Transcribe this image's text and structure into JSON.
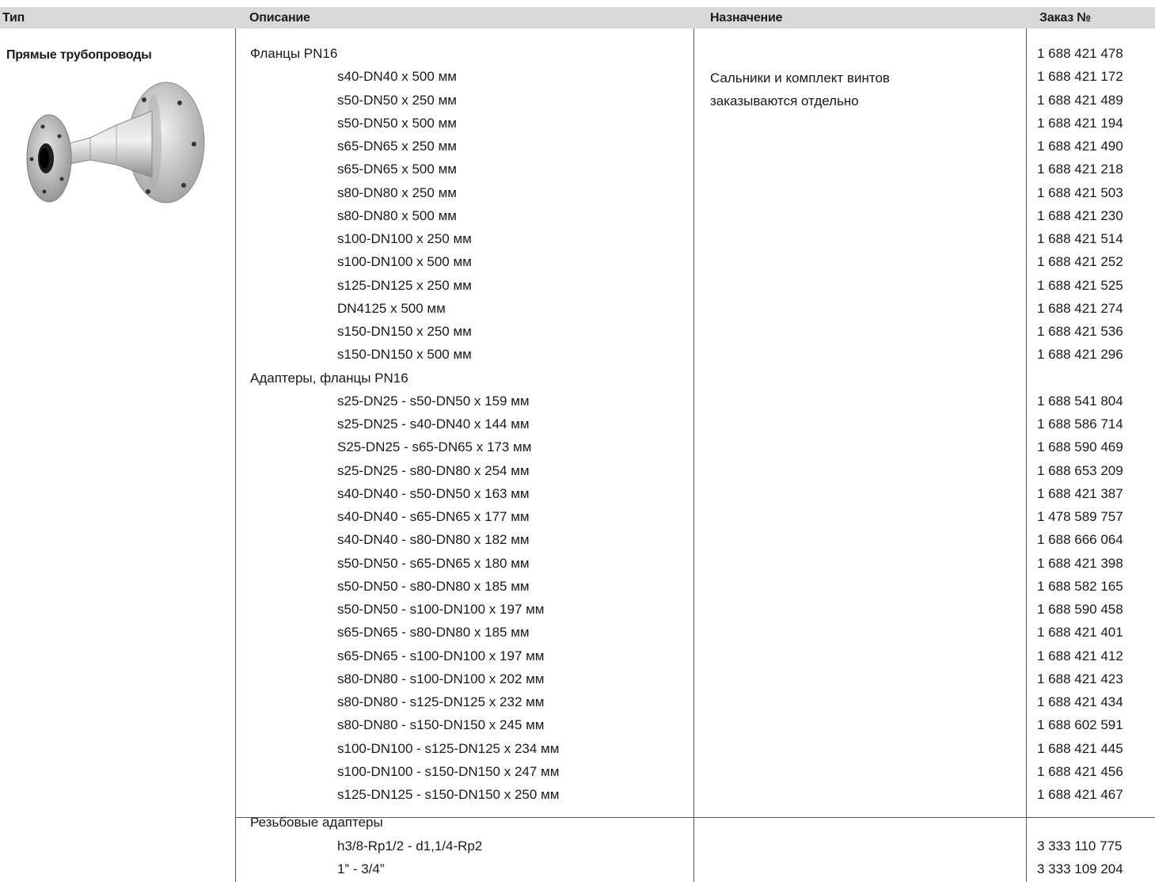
{
  "header": {
    "type": "Тип",
    "description": "Описание",
    "purpose": "Назначение",
    "order": "Заказ №"
  },
  "type_label": "Прямые трубопроводы",
  "purpose_text": {
    "line1": "Сальники и комплект винтов",
    "line2": "заказываются отдельно"
  },
  "rows": [
    {
      "desc": "Фланцы PN16",
      "order": "1 688 421 478",
      "level": "group"
    },
    {
      "desc": "s40-DN40 x 500 мм",
      "order": "1 688 421 172",
      "level": "item"
    },
    {
      "desc": "s50-DN50 x 250 мм",
      "order": "1 688 421 489",
      "level": "item"
    },
    {
      "desc": "s50-DN50 x 500 мм",
      "order": "1 688 421 194",
      "level": "item"
    },
    {
      "desc": "s65-DN65 x 250 мм",
      "order": "1 688 421 490",
      "level": "item"
    },
    {
      "desc": "s65-DN65 x 500 мм",
      "order": "1 688 421 218",
      "level": "item"
    },
    {
      "desc": "s80-DN80 x 250 мм",
      "order": "1 688 421 503",
      "level": "item"
    },
    {
      "desc": "s80-DN80 x 500 мм",
      "order": "1 688 421 230",
      "level": "item"
    },
    {
      "desc": "s100-DN100 x 250 мм",
      "order": "1 688 421 514",
      "level": "item"
    },
    {
      "desc": "s100-DN100 x 500 мм",
      "order": "1 688 421 252",
      "level": "item"
    },
    {
      "desc": "s125-DN125 x 250 мм",
      "order": "1 688 421 525",
      "level": "item"
    },
    {
      "desc": "DN4125 x 500 мм",
      "order": "1 688 421 274",
      "level": "item"
    },
    {
      "desc": "s150-DN150 x 250 мм",
      "order": "1 688 421 536",
      "level": "item"
    },
    {
      "desc": "s150-DN150 x 500 мм",
      "order": "1 688 421 296",
      "level": "item"
    },
    {
      "desc": "Адаптеры, фланцы PN16",
      "order": "",
      "level": "group"
    },
    {
      "desc": "s25-DN25 - s50-DN50 x 159 мм",
      "order": "1 688 541 804",
      "level": "item"
    },
    {
      "desc": "s25-DN25 - s40-DN40 x 144 мм",
      "order": "1 688 586 714",
      "level": "item"
    },
    {
      "desc": "S25-DN25 - s65-DN65 x 173 мм",
      "order": "1 688 590 469",
      "level": "item"
    },
    {
      "desc": "s25-DN25 - s80-DN80 x 254 мм",
      "order": "1 688 653 209",
      "level": "item"
    },
    {
      "desc": "s40-DN40 - s50-DN50 x 163 мм",
      "order": "1 688 421 387",
      "level": "item"
    },
    {
      "desc": "s40-DN40 - s65-DN65 x 177 мм",
      "order": "1 478 589 757",
      "level": "item"
    },
    {
      "desc": "s40-DN40 - s80-DN80 x 182 мм",
      "order": "1 688 666 064",
      "level": "item"
    },
    {
      "desc": "s50-DN50 - s65-DN65 x 180 мм",
      "order": "1 688 421 398",
      "level": "item"
    },
    {
      "desc": "s50-DN50 - s80-DN80 x 185 мм",
      "order": "1 688 582 165",
      "level": "item"
    },
    {
      "desc": "s50-DN50 - s100-DN100 x 197 мм",
      "order": "1 688 590 458",
      "level": "item"
    },
    {
      "desc": "s65-DN65 - s80-DN80 x 185 мм",
      "order": "1 688 421 401",
      "level": "item"
    },
    {
      "desc": "s65-DN65 - s100-DN100 x 197 мм",
      "order": "1 688 421 412",
      "level": "item"
    },
    {
      "desc": "s80-DN80 - s100-DN100 x 202 мм",
      "order": "1 688 421 423",
      "level": "item"
    },
    {
      "desc": "s80-DN80 - s125-DN125 x 232 мм",
      "order": "1 688 421 434",
      "level": "item"
    },
    {
      "desc": "s80-DN80 - s150-DN150 x 245 мм",
      "order": "1 688 602 591",
      "level": "item"
    },
    {
      "desc": "s100-DN100 - s125-DN125 x 234 мм",
      "order": "1 688 421 445",
      "level": "item"
    },
    {
      "desc": "s100-DN100 - s150-DN150 x 247 мм",
      "order": "1 688 421 456",
      "level": "item"
    },
    {
      "desc": "s125-DN125 - s150-DN150 x 250 мм",
      "order": "1 688 421 467",
      "level": "item"
    },
    {
      "desc": "Резьбовые адаптеры",
      "order": "",
      "level": "group"
    },
    {
      "desc": "h3/8-Rp1/2 - d1,1/4-Rp2",
      "order": "3 333 110 775",
      "level": "item"
    },
    {
      "desc": "1” - 3/4”",
      "order": "3 333 109 204",
      "level": "item"
    }
  ]
}
